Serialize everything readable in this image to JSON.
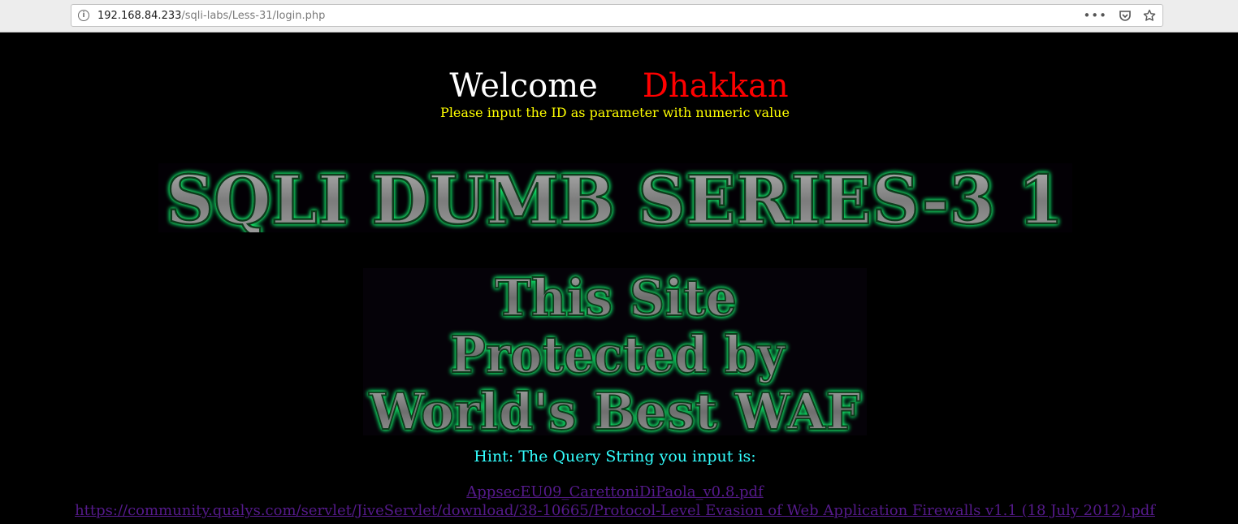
{
  "browser": {
    "url_host": "192.168.84.233",
    "url_path": "/sqli-labs/Less-31/login.php",
    "info_icon": "info-icon",
    "actions": [
      "more-icon",
      "pocket-icon",
      "star-icon"
    ]
  },
  "page": {
    "welcome_word": "Welcome",
    "welcome_name": "Dhakkan",
    "instruction": "Please input the ID as parameter with numeric value",
    "banner_title": "SQLI DUMB SERIES-3 1",
    "waf_lines": [
      "This Site",
      "Protected by",
      "World's Best WAF"
    ],
    "hint": "Hint: The Query String you input is:",
    "links": [
      "AppsecEU09_CarettoniDiPaola_v0.8.pdf",
      "https://community.qualys.com/servlet/JiveServlet/download/38-10665/Protocol-Level Evasion of Web Application Firewalls v1.1 (18 July 2012).pdf"
    ]
  },
  "colors": {
    "background": "#000000",
    "welcome": "#ffffff",
    "name": "#ff0000",
    "instruction": "#ffff00",
    "hint": "#33ffff",
    "link": "#551a8b",
    "glow": "#17e86b",
    "metal": "#8a8a8a"
  }
}
